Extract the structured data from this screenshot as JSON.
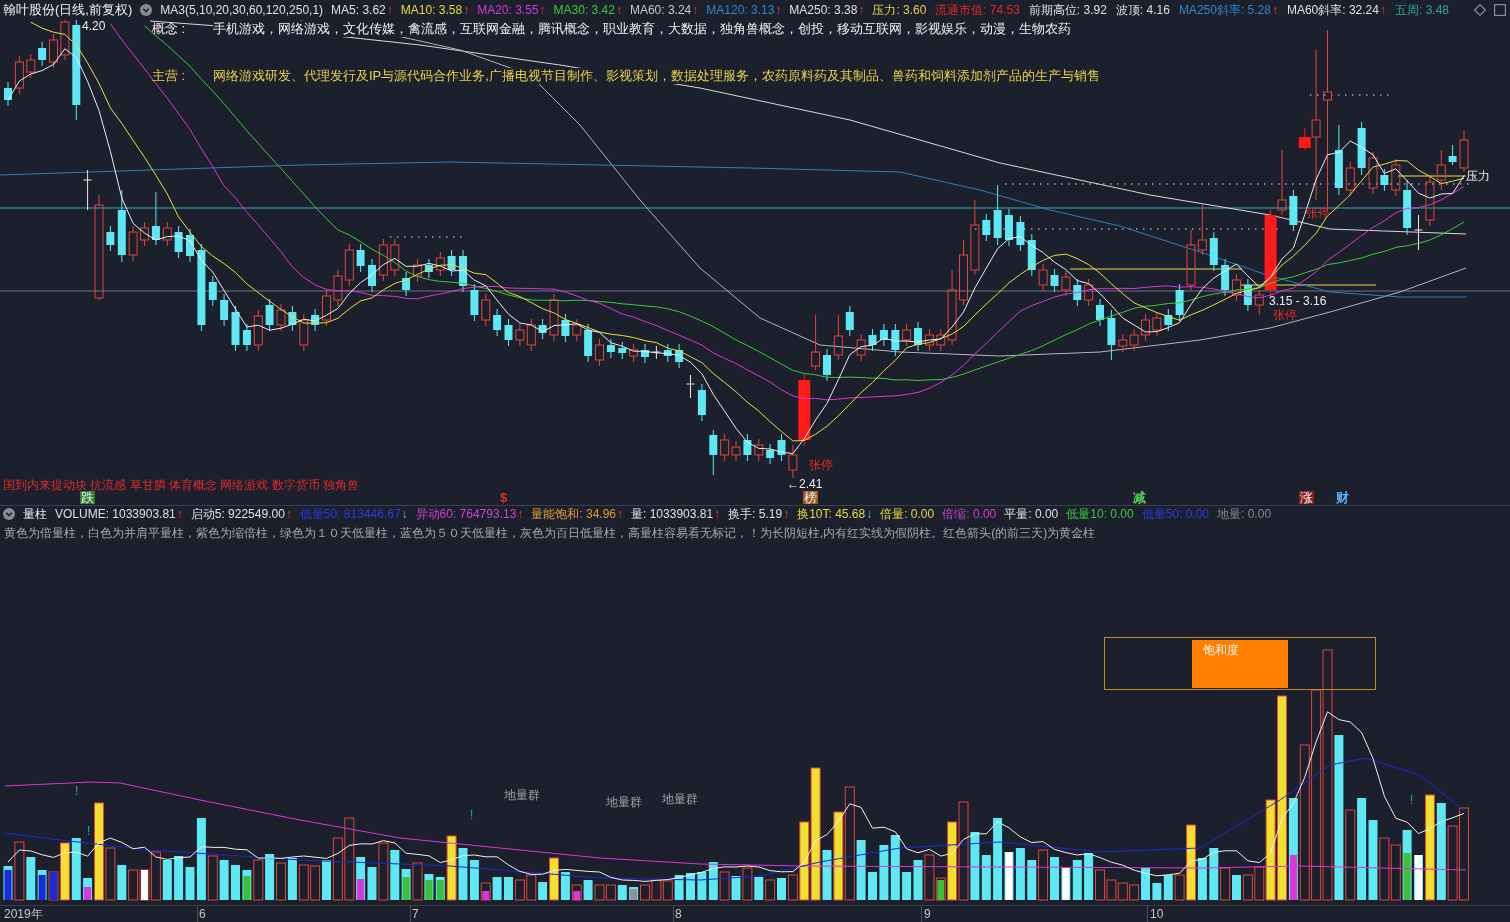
{
  "header": {
    "title": "翰叶股份(日线,前复权)",
    "indicator": "MA3(5,10,20,30,60,120,250,1)",
    "items": [
      {
        "text": "MA5: 3.62",
        "color": "#e0e0e0",
        "arrow": "↑",
        "rising": true
      },
      {
        "text": "MA10: 3.58",
        "color": "#e6dc3c",
        "arrow": "↑",
        "rising": true
      },
      {
        "text": "MA20: 3.55",
        "color": "#d838d8",
        "arrow": "↑",
        "rising": true
      },
      {
        "text": "MA30: 3.42",
        "color": "#3cc83c",
        "arrow": "↑",
        "rising": true
      },
      {
        "text": "MA60: 3.24",
        "color": "#c8c8c8",
        "arrow": "↑",
        "rising": true
      },
      {
        "text": "MA120: 3.13",
        "color": "#2f86c8",
        "arrow": "↑",
        "rising": true
      },
      {
        "text": "MA250: 3.38",
        "color": "#e0e0e0",
        "arrow": "↑",
        "rising": true
      },
      {
        "text": "压力: 3.60",
        "color": "#e8d34a"
      }
    ],
    "stats": [
      {
        "text": "流通市值: 74.53",
        "color": "#e02828"
      },
      {
        "text": "前期高位: 3.92",
        "color": "#e0e0e0"
      },
      {
        "text": "波顶: 4.16",
        "color": "#e0e0e0"
      },
      {
        "text": "MA250斜率: 5.28",
        "color": "#2f86c8",
        "arrow": "↑",
        "rising": true
      },
      {
        "text": "MA60斜率: 32.24",
        "color": "#e0e0e0",
        "arrow": "↑",
        "rising": true
      },
      {
        "text": "五周: 3.48",
        "color": "#2fa898"
      }
    ]
  },
  "chart": {
    "concept": {
      "label": "概念 :",
      "text": "手机游戏，网络游戏，文化传媒，禽流感，互联网金融，腾讯概念，职业教育，大数据，独角兽概念，创投，移动互联网，影视娱乐，动漫，生物农药"
    },
    "business": {
      "label": "主营 :",
      "text": "网络游戏研发、代理发行及IP与源代码合作业务,广播电视节目制作、影视策划，数据处理服务，农药原料药及其制品、兽药和饲料添加剂产品的生产与销售"
    },
    "annotations": [
      {
        "text": "4.20",
        "kind": "price"
      },
      {
        "text": "←2.41",
        "kind": "price"
      },
      {
        "text": "3.15 - 3.16",
        "kind": "price"
      },
      {
        "text": "张停",
        "kind": "limit"
      },
      {
        "text": "张停",
        "kind": "limit"
      },
      {
        "text": "张停",
        "kind": "limit"
      },
      {
        "text": "压力",
        "kind": "price"
      }
    ],
    "themes": "国到内来提动块 抗流感 草甘膦 体育概念 网络游戏 数字货币 独角兽",
    "signals": [
      {
        "text": "跌",
        "kind": "tile",
        "color": "#2e7d32"
      },
      {
        "text": "$",
        "kind": "plain",
        "color": "#e03030"
      },
      {
        "text": "榜",
        "kind": "tile",
        "color": "#9a5a1e"
      },
      {
        "text": "减",
        "kind": "plain",
        "color": "#4fd04f"
      },
      {
        "text": "涨",
        "kind": "tile",
        "color": "#8b1c1c"
      },
      {
        "text": "财",
        "kind": "plain",
        "color": "#5ab4ff"
      }
    ]
  },
  "volume_panel": {
    "title": "量柱",
    "readings": [
      {
        "text": "VOLUME: 1033903.81",
        "color": "#e0e0e0",
        "arrow": "↑",
        "rising": true
      },
      {
        "text": "启动5: 922549.00",
        "color": "#e0e0e0",
        "arrow": "↑",
        "rising": true
      },
      {
        "text": "低量50: 813446.67",
        "color": "#2a3ae0",
        "arrow": "↓",
        "rising": false
      },
      {
        "text": "异动60: 764793.13",
        "color": "#d040d0",
        "arrow": "↑",
        "rising": true
      },
      {
        "text": "量能饱和: 34.96",
        "color": "#e89a3a",
        "arrow": "↑",
        "rising": true
      },
      {
        "text": "量: 1033903.81",
        "color": "#e0e0e0",
        "arrow": "↑",
        "rising": true
      },
      {
        "text": "换手: 5.19",
        "color": "#e0e0e0",
        "arrow": "↑",
        "rising": true
      },
      {
        "text": "换10T: 45.68",
        "color": "#e8dc3c",
        "arrow": "↓",
        "rising": false
      },
      {
        "text": "倍量: 0.00",
        "color": "#e8dc3c"
      },
      {
        "text": "倍缩: 0.00",
        "color": "#d040d0"
      },
      {
        "text": "平量: 0.00",
        "color": "#e0e0e0"
      },
      {
        "text": "低量10: 0.00",
        "color": "#3cc83c"
      },
      {
        "text": "低量50: 0.00",
        "color": "#2a3ae0"
      },
      {
        "text": "地量: 0.00",
        "color": "#8a8a8a"
      }
    ],
    "note": "黄色为倍量柱，白色为并肩平量柱，紫色为缩倍柱，绿色为１０天低量柱，蓝色为５０天低量柱，灰色为百日低量柱，高量柱容易看无标记，！为长阴短柱,内有红实线为假阴柱。红色箭头(的前三天)为黄金柱",
    "gauge": {
      "label": "饱和度"
    },
    "annotations": [
      {
        "text": "地量群",
        "kind": "cluster"
      },
      {
        "text": "地量群",
        "kind": "cluster"
      },
      {
        "text": "地量群",
        "kind": "cluster"
      },
      {
        "text": "!",
        "kind": "alert"
      },
      {
        "text": "!",
        "kind": "alert"
      },
      {
        "text": "!",
        "kind": "alert"
      },
      {
        "text": "!",
        "kind": "alert"
      }
    ]
  },
  "x_axis": {
    "labels": [
      "2019年",
      "6",
      "7",
      "8",
      "9",
      "10"
    ]
  }
}
